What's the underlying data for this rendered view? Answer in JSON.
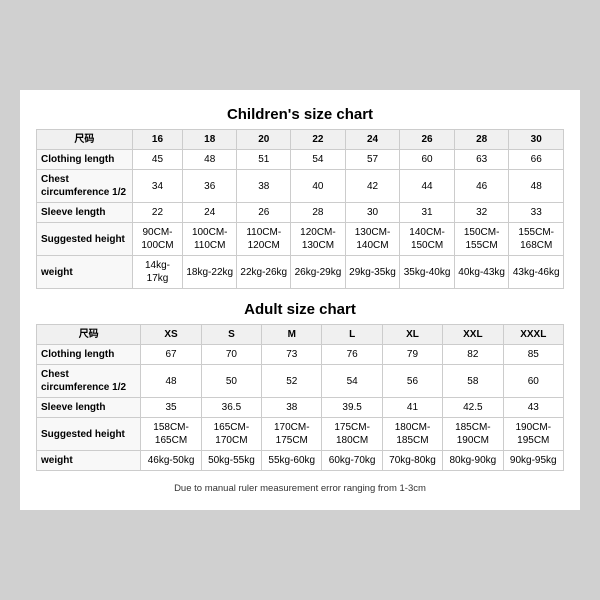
{
  "children_chart": {
    "title": "Children's size chart",
    "columns": [
      "尺码",
      "16",
      "18",
      "20",
      "22",
      "24",
      "26",
      "28",
      "30"
    ],
    "rows": [
      {
        "label": "Clothing length",
        "values": [
          "45",
          "48",
          "51",
          "54",
          "57",
          "60",
          "63",
          "66"
        ]
      },
      {
        "label": "Chest circumference 1/2",
        "values": [
          "34",
          "36",
          "38",
          "40",
          "42",
          "44",
          "46",
          "48"
        ]
      },
      {
        "label": "Sleeve length",
        "values": [
          "22",
          "24",
          "26",
          "28",
          "30",
          "31",
          "32",
          "33"
        ]
      },
      {
        "label": "Suggested height",
        "values": [
          "90CM-100CM",
          "100CM-110CM",
          "110CM-120CM",
          "120CM-130CM",
          "130CM-140CM",
          "140CM-150CM",
          "150CM-155CM",
          "155CM-168CM"
        ]
      },
      {
        "label": "weight",
        "values": [
          "14kg-17kg",
          "18kg-22kg",
          "22kg-26kg",
          "26kg-29kg",
          "29kg-35kg",
          "35kg-40kg",
          "40kg-43kg",
          "43kg-46kg"
        ]
      }
    ]
  },
  "adult_chart": {
    "title": "Adult size chart",
    "columns": [
      "尺码",
      "XS",
      "S",
      "M",
      "L",
      "XL",
      "XXL",
      "XXXL"
    ],
    "rows": [
      {
        "label": "Clothing length",
        "values": [
          "67",
          "70",
          "73",
          "76",
          "79",
          "82",
          "85"
        ]
      },
      {
        "label": "Chest circumference 1/2",
        "values": [
          "48",
          "50",
          "52",
          "54",
          "56",
          "58",
          "60"
        ]
      },
      {
        "label": "Sleeve length",
        "values": [
          "35",
          "36.5",
          "38",
          "39.5",
          "41",
          "42.5",
          "43"
        ]
      },
      {
        "label": "Suggested height",
        "values": [
          "158CM-165CM",
          "165CM-170CM",
          "170CM-175CM",
          "175CM-180CM",
          "180CM-185CM",
          "185CM-190CM",
          "190CM-195CM"
        ]
      },
      {
        "label": "weight",
        "values": [
          "46kg-50kg",
          "50kg-55kg",
          "55kg-60kg",
          "60kg-70kg",
          "70kg-80kg",
          "80kg-90kg",
          "90kg-95kg"
        ]
      }
    ]
  },
  "note": "Due to manual ruler measurement error ranging from 1-3cm"
}
